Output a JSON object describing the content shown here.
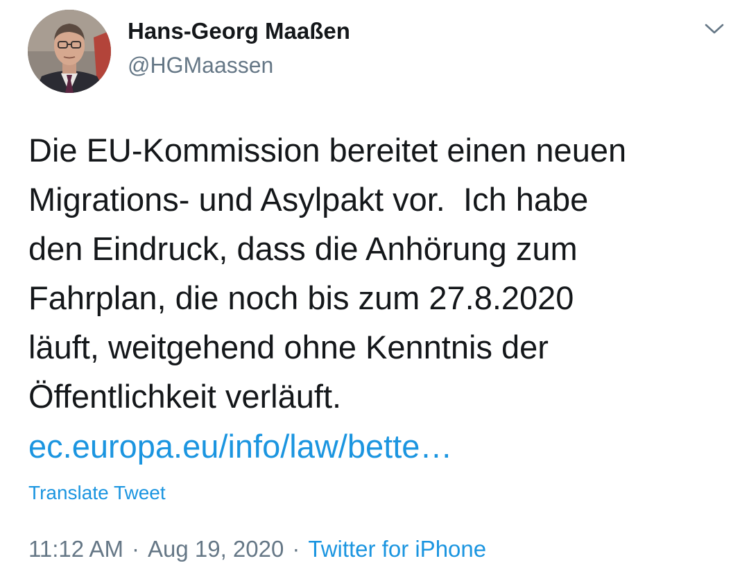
{
  "user": {
    "display_name": "Hans-Georg Maaßen",
    "handle": "@HGMaassen"
  },
  "tweet": {
    "text_lines": [
      "Die EU-Kommission bereitet einen neuen",
      "Migrations- und Asylpakt vor.  Ich habe",
      "den Eindruck, dass die Anhörung zum",
      "Fahrplan, die noch bis zum 27.8.2020",
      "läuft, weitgehend ohne Kenntnis der",
      "Öffentlichkeit verläuft."
    ],
    "link_text": "ec.europa.eu/info/law/bette…",
    "translate_label": "Translate Tweet",
    "time": "11:12 AM",
    "separator": "·",
    "date": "Aug 19, 2020",
    "source": "Twitter for iPhone"
  },
  "icons": {
    "menu": "chevron-down-icon",
    "avatar": "avatar-photo"
  },
  "colors": {
    "text": "#14171a",
    "secondary": "#657786",
    "link": "#1b95e0",
    "background": "#ffffff"
  }
}
